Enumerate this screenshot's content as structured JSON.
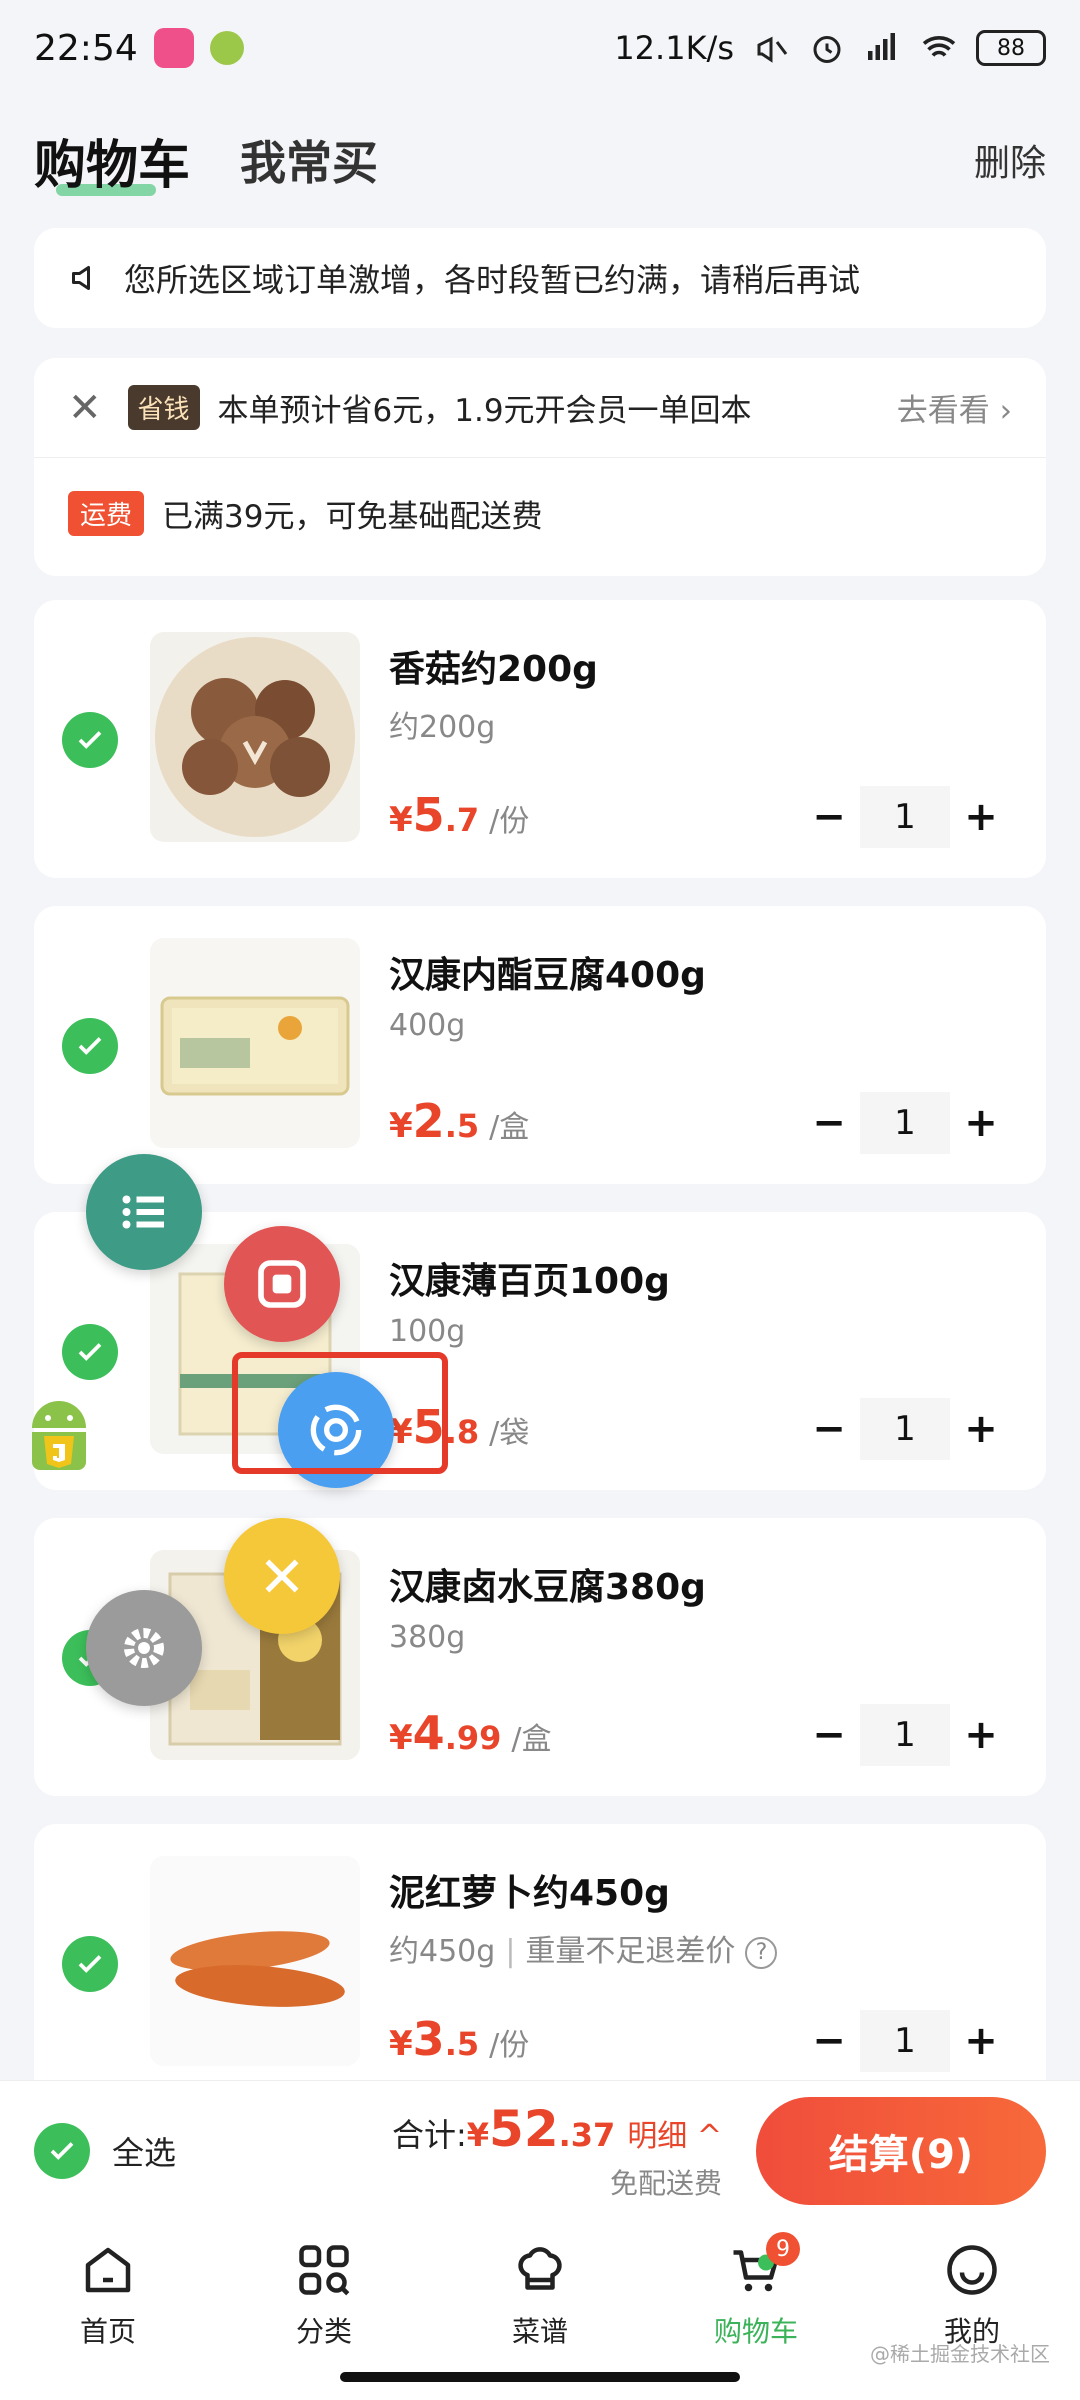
{
  "status_bar": {
    "time": "22:54",
    "speed": "12.1K/s",
    "battery": "88"
  },
  "header": {
    "tab_cart": "购物车",
    "tab_often": "我常买",
    "delete_label": "删除"
  },
  "notice": {
    "text": "您所选区域订单激增，各时段暂已约满，请稍后再试"
  },
  "promo": {
    "save_tag": "省钱",
    "save_text": "本单预计省6元，1.9元开会员一单回本",
    "go_label": "去看看 ›",
    "fee_tag": "运费",
    "fee_text": "已满39元，可免基础配送费"
  },
  "items": [
    {
      "title": "香菇约200g",
      "spec": "约200g",
      "currency": "¥",
      "price_int": "5",
      "price_dec": ".7",
      "unit": "/份",
      "qty": "1",
      "minus": "−",
      "plus": "+"
    },
    {
      "title": "汉康内酯豆腐400g",
      "spec": "400g",
      "currency": "¥",
      "price_int": "2",
      "price_dec": ".5",
      "unit": "/盒",
      "qty": "1",
      "minus": "−",
      "plus": "+"
    },
    {
      "title": "汉康薄百页100g",
      "spec": "100g",
      "currency": "¥",
      "price_int": "5",
      "price_dec": ".8",
      "unit": "/袋",
      "qty": "1",
      "minus": "−",
      "plus": "+"
    },
    {
      "title": "汉康卤水豆腐380g",
      "spec": "380g",
      "currency": "¥",
      "price_int": "4",
      "price_dec": ".99",
      "unit": "/盒",
      "qty": "1",
      "minus": "−",
      "plus": "+"
    },
    {
      "title": "泥红萝卜约450g",
      "spec": "约450g",
      "spec_extra": "重量不足退差价",
      "help": "?",
      "currency": "¥",
      "price_int": "3",
      "price_dec": ".5",
      "unit": "/份",
      "qty": "1",
      "minus": "−",
      "plus": "+"
    }
  ],
  "summary": {
    "select_all": "全选",
    "total_label": "合计:",
    "currency": "¥",
    "total_int": "52",
    "total_dec": ".37",
    "detail": "明细 ^",
    "free_delivery": "免配送费",
    "checkout": "结算(9)"
  },
  "nav": {
    "home": "首页",
    "category": "分类",
    "recipe": "菜谱",
    "cart": "购物车",
    "cart_badge": "9",
    "mine": "我的"
  },
  "watermark": "@稀土掘金技术社区",
  "colors": {
    "accent_green": "#3cbf5a",
    "price_red": "#e8452a",
    "checkout_red": "#f04d3b"
  }
}
